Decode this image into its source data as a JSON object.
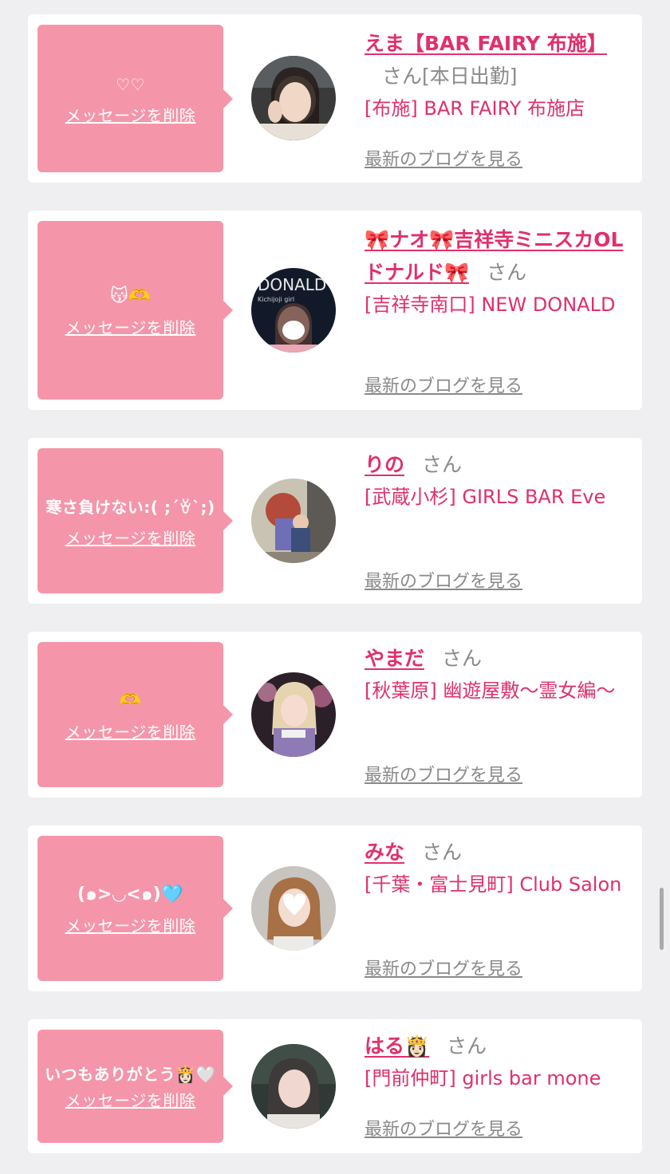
{
  "common": {
    "delete_label": "メッセージを削除",
    "blog_label": "最新のブログを見る",
    "san_label": "さん"
  },
  "entries": [
    {
      "message": "♡♡",
      "name": "えま【BAR FAIRY 布施】",
      "status": "[本日出勤]",
      "shop": "[布施] BAR FAIRY 布施店"
    },
    {
      "message": "😽🫶",
      "name": "🎀ナオ🎀吉祥寺ミニスカOLドナルド🎀",
      "status": "",
      "shop": "[吉祥寺南口] NEW DONALD"
    },
    {
      "message": "寒さ負けない:( ;´ꈊ`;)",
      "name": "りの",
      "status": "",
      "shop": "[武蔵小杉] GIRLS BAR Eve"
    },
    {
      "message": "🫶",
      "name": "やまだ",
      "status": "",
      "shop": "[秋葉原] 幽遊屋敷〜霊女編〜"
    },
    {
      "message": "(๑>◡<๑)🩵",
      "name": "みな",
      "status": "",
      "shop": "[千葉・富士見町] Club Salon"
    },
    {
      "message": "いつもありがとう👸🏻🤍",
      "name": "はる👸🏻",
      "status": "",
      "shop": "[門前仲町] girls bar mone"
    }
  ],
  "colors": {
    "bubble": "#f595a9",
    "accent": "#e0306a",
    "muted": "#8a8a8a",
    "background": "#efeff1"
  },
  "icons": [
    "avatar-photo"
  ]
}
